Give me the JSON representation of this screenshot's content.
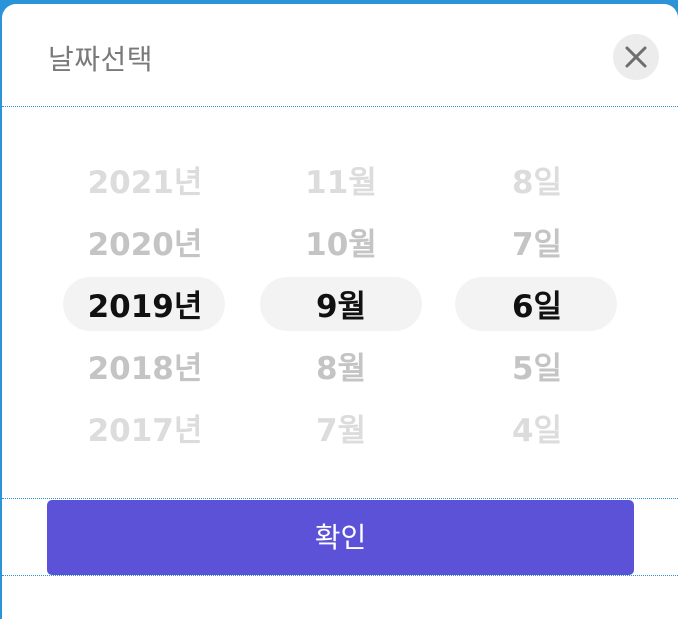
{
  "dialog": {
    "title": "날짜선택",
    "close_icon": "close-icon",
    "confirm_label": "확인"
  },
  "picker": {
    "years": [
      "2021년",
      "2020년",
      "2019년",
      "2018년",
      "2017년"
    ],
    "months": [
      "11월",
      "10월",
      "9월",
      "8월",
      "7월"
    ],
    "days": [
      "8일",
      "7일",
      "6일",
      "5일",
      "4일"
    ],
    "selected": {
      "year": "2019년",
      "month": "9월",
      "day": "6일"
    }
  },
  "colors": {
    "accent": "#5b52d8",
    "frame": "#2b93d8",
    "selected_text": "#111111",
    "faded_text": "#c4c4c4"
  }
}
